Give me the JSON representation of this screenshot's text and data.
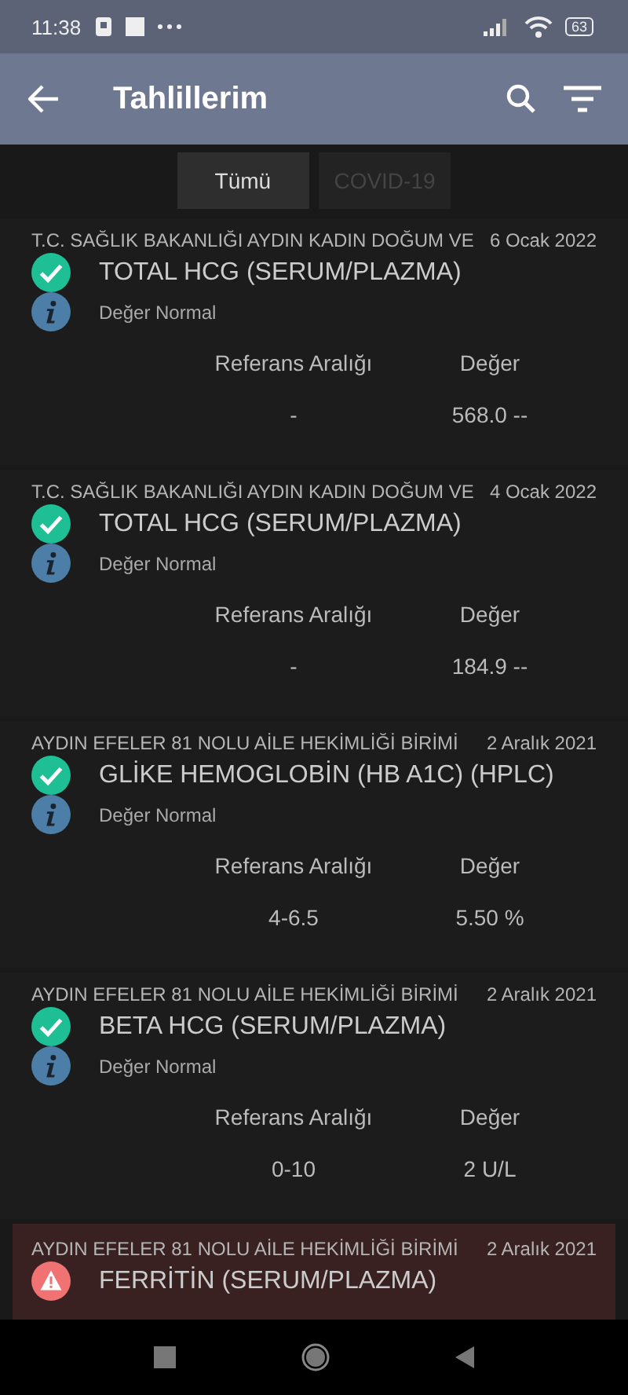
{
  "status_bar": {
    "time": "11:38",
    "battery": "63"
  },
  "app_bar": {
    "title": "Tahlillerim"
  },
  "tabs": [
    {
      "label": "Tümü",
      "selected": true
    },
    {
      "label": "COVID-19",
      "selected": false
    }
  ],
  "results": [
    {
      "kind": "normal",
      "institution": "T.C. SAĞLIK BAKANLIĞI AYDIN KADIN DOĞUM VE",
      "date": "6 Ocak 2022",
      "test": "TOTAL HCG (SERUM/PLAZMA)",
      "status": "Değer Normal",
      "range_label": "Referans Aralığı",
      "value_label": "Değer",
      "range": "-",
      "value": "568.0 --"
    },
    {
      "kind": "normal",
      "institution": "T.C. SAĞLIK BAKANLIĞI AYDIN KADIN DOĞUM VE",
      "date": "4 Ocak 2022",
      "test": "TOTAL HCG (SERUM/PLAZMA)",
      "status": "Değer Normal",
      "range_label": "Referans Aralığı",
      "value_label": "Değer",
      "range": "-",
      "value": "184.9 --"
    },
    {
      "kind": "normal",
      "institution": "AYDIN EFELER 81 NOLU AİLE HEKİMLİĞİ BİRİMİ",
      "date": "2 Aralık 2021",
      "test": "GLİKE HEMOGLOBİN (HB A1C) (HPLC)",
      "status": "Değer Normal",
      "range_label": "Referans Aralığı",
      "value_label": "Değer",
      "range": "4-6.5",
      "value": "5.50 %"
    },
    {
      "kind": "normal",
      "institution": "AYDIN EFELER 81 NOLU AİLE HEKİMLİĞİ BİRİMİ",
      "date": "2 Aralık 2021",
      "test": "BETA HCG (SERUM/PLAZMA)",
      "status": "Değer Normal",
      "range_label": "Referans Aralığı",
      "value_label": "Değer",
      "range": "0-10",
      "value": "2 U/L"
    },
    {
      "kind": "warning",
      "institution": "AYDIN EFELER 81 NOLU AİLE HEKİMLİĞİ BİRİMİ",
      "date": "2 Aralık 2021",
      "test": "FERRİTİN (SERUM/PLAZMA)"
    }
  ]
}
